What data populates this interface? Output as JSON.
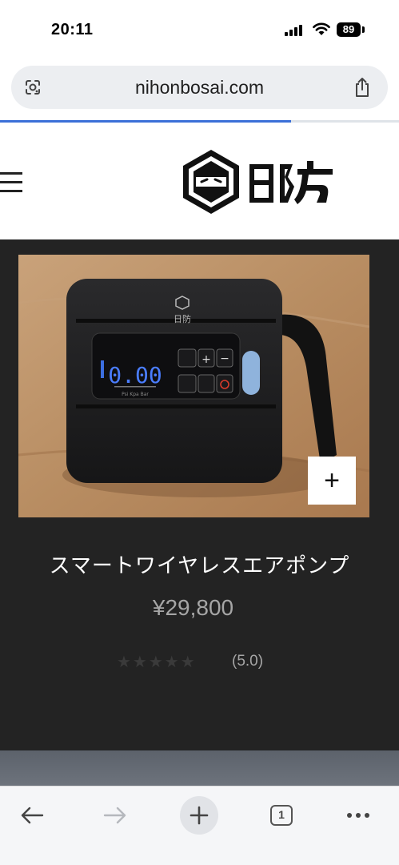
{
  "status_bar": {
    "time": "20:11",
    "battery": "89",
    "icons": [
      "signal-icon",
      "wifi-icon",
      "battery-icon"
    ]
  },
  "browser": {
    "url": "nihonbosai.com",
    "icons": [
      "google-lens-icon",
      "share-icon"
    ],
    "load_progress_percent": 73
  },
  "site_header": {
    "logo_alt": "日防",
    "menu_icon": "hamburger-menu-icon"
  },
  "product": {
    "image_brand": "日防",
    "image_display": "0.00",
    "image_units": [
      "Psi",
      "Kpa",
      "Bar"
    ],
    "add_button_label": "+",
    "title": "スマートワイヤレスエアポンプ",
    "price": "¥29,800",
    "rating_stars": "★★★★★",
    "rating_value": 5.0,
    "rating_text": "(5.0)"
  },
  "toolbar": {
    "back_icon": "arrow-left-icon",
    "forward_icon": "arrow-right-icon",
    "new_tab_icon": "plus-icon",
    "tab_count": "1",
    "more_icon": "more-horizontal-icon"
  },
  "colors": {
    "dark_background": "#232323",
    "accent_blue": "#3b6fd8",
    "price_gray": "#a6a6a6"
  }
}
